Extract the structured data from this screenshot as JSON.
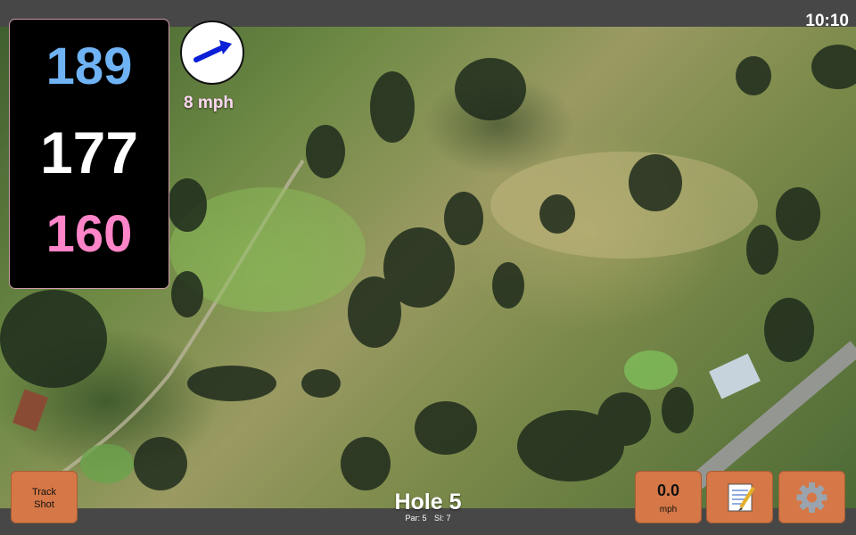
{
  "status_bar": {
    "time": "10:10"
  },
  "distances": {
    "back": "189",
    "center": "177",
    "front": "160"
  },
  "wind": {
    "speed_label": "8 mph"
  },
  "buttons": {
    "track_shot_line1": "Track",
    "track_shot_line2": "Shot",
    "wind_value": "0.0",
    "wind_unit": "mph",
    "notes_icon": "notepad-icon",
    "settings_icon": "gear-icon"
  },
  "hole": {
    "title": "Hole 5",
    "par": "Par: 5",
    "si": "SI: 7"
  },
  "colors": {
    "back": "#6fb3f5",
    "center": "#ffffff",
    "front": "#ff85c8",
    "button": "#d57746",
    "wind_arrow": "#0a1fd6"
  },
  "icons": {
    "map": "satellite-map",
    "wind_direction": "wind-arrow-icon"
  }
}
